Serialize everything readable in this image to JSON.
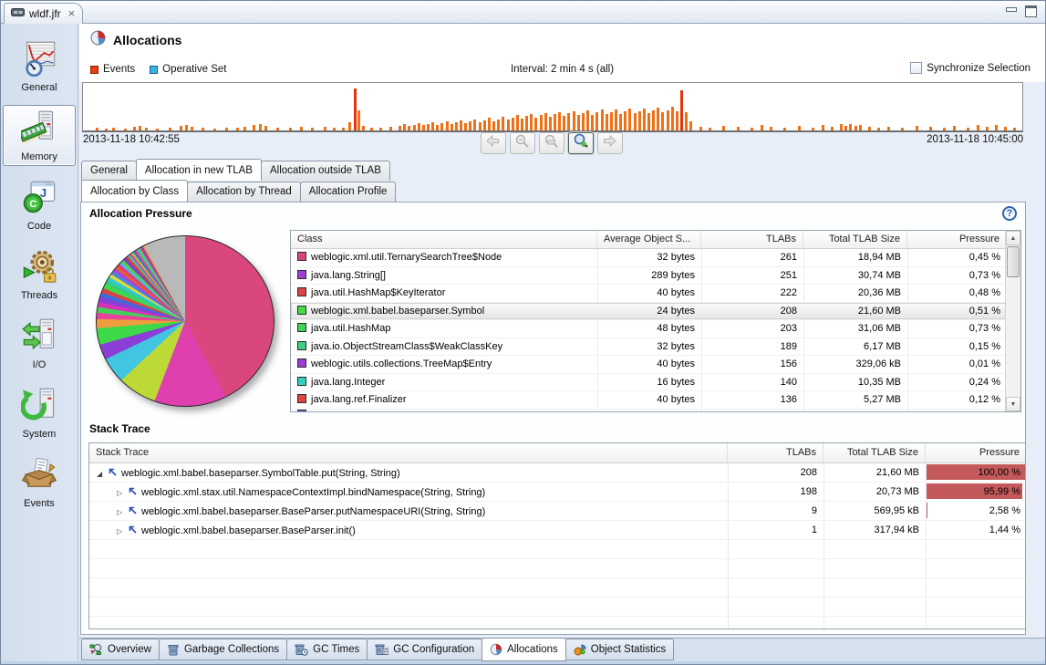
{
  "window": {
    "tab_title": "wldf.jfr"
  },
  "sidebar": {
    "items": [
      {
        "label": "General",
        "icon": "general",
        "selected": false
      },
      {
        "label": "Memory",
        "icon": "memory",
        "selected": true
      },
      {
        "label": "Code",
        "icon": "code",
        "selected": false
      },
      {
        "label": "Threads",
        "icon": "threads",
        "selected": false
      },
      {
        "label": "I/O",
        "icon": "io",
        "selected": false
      },
      {
        "label": "System",
        "icon": "system",
        "selected": false
      },
      {
        "label": "Events",
        "icon": "events",
        "selected": false
      }
    ]
  },
  "header": {
    "title": "Allocations"
  },
  "legend": {
    "events": "Events",
    "operative_set": "Operative Set",
    "interval": "Interval: 2 min 4 s (all)",
    "sync": "Synchronize Selection"
  },
  "timeline": {
    "start": "2013-11-18 10:42:55",
    "end": "2013-11-18 10:45:00",
    "bar_color": "#f07017",
    "spike_color": "#e5330e",
    "bars": [
      [
        1.4,
        5
      ],
      [
        2.3,
        4
      ],
      [
        3.1,
        6
      ],
      [
        4.4,
        4
      ],
      [
        5.3,
        7
      ],
      [
        5.9,
        9
      ],
      [
        6.6,
        6
      ],
      [
        7.8,
        4
      ],
      [
        9.1,
        5
      ],
      [
        10.3,
        10
      ],
      [
        10.9,
        12
      ],
      [
        11.5,
        8
      ],
      [
        12.6,
        5
      ],
      [
        13.9,
        4
      ],
      [
        15.1,
        6
      ],
      [
        16.3,
        5
      ],
      [
        17.1,
        7
      ],
      [
        18.1,
        11
      ],
      [
        18.7,
        13
      ],
      [
        19.3,
        9
      ],
      [
        20.6,
        5
      ],
      [
        21.9,
        6
      ],
      [
        23.1,
        8
      ],
      [
        24.3,
        5
      ],
      [
        25.6,
        7
      ],
      [
        26.6,
        5
      ],
      [
        27.6,
        6
      ],
      [
        28.3,
        18
      ],
      [
        28.8,
        88,
        1
      ],
      [
        29.2,
        42
      ],
      [
        29.7,
        10
      ],
      [
        30.6,
        6
      ],
      [
        31.6,
        5
      ],
      [
        32.6,
        7
      ],
      [
        33.6,
        10
      ],
      [
        34.1,
        13
      ],
      [
        34.6,
        9
      ],
      [
        35.1,
        12
      ],
      [
        35.6,
        15
      ],
      [
        36.1,
        11
      ],
      [
        36.6,
        14
      ],
      [
        37.1,
        17
      ],
      [
        37.6,
        12
      ],
      [
        38.1,
        15
      ],
      [
        38.6,
        19
      ],
      [
        39.1,
        14
      ],
      [
        39.6,
        17
      ],
      [
        40.1,
        21
      ],
      [
        40.6,
        16
      ],
      [
        41.1,
        19
      ],
      [
        41.6,
        23
      ],
      [
        42.1,
        18
      ],
      [
        42.6,
        22
      ],
      [
        43.1,
        26
      ],
      [
        43.6,
        20
      ],
      [
        44.1,
        24
      ],
      [
        44.6,
        29
      ],
      [
        45.1,
        23
      ],
      [
        45.6,
        27
      ],
      [
        46.1,
        32
      ],
      [
        46.6,
        25
      ],
      [
        47.1,
        30
      ],
      [
        47.6,
        35
      ],
      [
        48.1,
        27
      ],
      [
        48.6,
        32
      ],
      [
        49.1,
        37
      ],
      [
        49.6,
        29
      ],
      [
        50.1,
        34
      ],
      [
        50.6,
        39
      ],
      [
        51.1,
        31
      ],
      [
        51.6,
        36
      ],
      [
        52.1,
        41
      ],
      [
        52.6,
        32
      ],
      [
        53.1,
        37
      ],
      [
        53.6,
        43
      ],
      [
        54.1,
        33
      ],
      [
        54.6,
        38
      ],
      [
        55.1,
        44
      ],
      [
        55.6,
        34
      ],
      [
        56.1,
        39
      ],
      [
        56.6,
        45
      ],
      [
        57.1,
        35
      ],
      [
        57.6,
        40
      ],
      [
        58.1,
        46
      ],
      [
        58.6,
        36
      ],
      [
        59.1,
        41
      ],
      [
        59.6,
        47
      ],
      [
        60.1,
        37
      ],
      [
        60.6,
        42
      ],
      [
        61.1,
        48
      ],
      [
        61.6,
        38
      ],
      [
        62.1,
        43
      ],
      [
        62.6,
        50
      ],
      [
        63.1,
        40
      ],
      [
        63.6,
        85,
        1
      ],
      [
        64.1,
        38
      ],
      [
        64.6,
        20
      ],
      [
        65.6,
        8
      ],
      [
        66.6,
        6
      ],
      [
        68.1,
        10
      ],
      [
        69.6,
        7
      ],
      [
        71.1,
        5
      ],
      [
        72.1,
        12
      ],
      [
        73.1,
        8
      ],
      [
        74.6,
        6
      ],
      [
        76.1,
        9
      ],
      [
        77.6,
        5
      ],
      [
        78.6,
        11
      ],
      [
        79.6,
        7
      ],
      [
        80.6,
        13
      ],
      [
        81.1,
        9
      ],
      [
        81.6,
        14
      ],
      [
        82.1,
        10
      ],
      [
        82.6,
        12
      ],
      [
        83.6,
        7
      ],
      [
        84.6,
        5
      ],
      [
        85.6,
        8
      ],
      [
        87.1,
        6
      ],
      [
        88.6,
        10
      ],
      [
        90.1,
        7
      ],
      [
        91.6,
        5
      ],
      [
        92.6,
        9
      ],
      [
        94.1,
        6
      ],
      [
        95.1,
        11
      ],
      [
        96.1,
        8
      ],
      [
        97.1,
        12
      ],
      [
        98.1,
        7
      ],
      [
        99.0,
        5
      ]
    ]
  },
  "toolbar": {
    "buttons": [
      {
        "name": "back",
        "icon": "arrow-left",
        "enabled": false
      },
      {
        "name": "zoom-out",
        "icon": "mag-minus",
        "enabled": false
      },
      {
        "name": "zoom-selection",
        "icon": "mag-select",
        "enabled": false
      },
      {
        "name": "zoom-in",
        "icon": "mag-plus",
        "enabled": true
      },
      {
        "name": "forward",
        "icon": "arrow-right",
        "enabled": false
      }
    ]
  },
  "tabs_row1": [
    {
      "label": "General",
      "active": false
    },
    {
      "label": "Allocation in new TLAB",
      "active": true
    },
    {
      "label": "Allocation outside TLAB",
      "active": false
    }
  ],
  "tabs_row2": [
    {
      "label": "Allocation by Class",
      "active": true
    },
    {
      "label": "Allocation by Thread",
      "active": false
    },
    {
      "label": "Allocation Profile",
      "active": false
    }
  ],
  "allocation_pressure": {
    "title": "Allocation Pressure",
    "help": "?",
    "columns": [
      "Class",
      "Average Object S...",
      "TLABs",
      "Total TLAB Size",
      "Pressure"
    ],
    "rows": [
      {
        "color": "#d9477e",
        "class": "weblogic.xml.util.TernarySearchTree$Node",
        "avg": "32 bytes",
        "tlabs": "261",
        "size": "18,94 MB",
        "pressure": "0,45 %",
        "selected": false
      },
      {
        "color": "#9b3fd6",
        "class": "java.lang.String[]",
        "avg": "289 bytes",
        "tlabs": "251",
        "size": "30,74 MB",
        "pressure": "0,73 %",
        "selected": false
      },
      {
        "color": "#dd4444",
        "class": "java.util.HashMap$KeyIterator",
        "avg": "40 bytes",
        "tlabs": "222",
        "size": "20,36 MB",
        "pressure": "0,48 %",
        "selected": false
      },
      {
        "color": "#44dd44",
        "class": "weblogic.xml.babel.baseparser.Symbol",
        "avg": "24 bytes",
        "tlabs": "208",
        "size": "21,60 MB",
        "pressure": "0,51 %",
        "selected": true
      },
      {
        "color": "#3fd455",
        "class": "java.util.HashMap",
        "avg": "48 bytes",
        "tlabs": "203",
        "size": "31,06 MB",
        "pressure": "0,73 %",
        "selected": false
      },
      {
        "color": "#3bd088",
        "class": "java.io.ObjectStreamClass$WeakClassKey",
        "avg": "32 bytes",
        "tlabs": "189",
        "size": "6,17 MB",
        "pressure": "0,15 %",
        "selected": false
      },
      {
        "color": "#9b3fd6",
        "class": "weblogic.utils.collections.TreeMap$Entry",
        "avg": "40 bytes",
        "tlabs": "156",
        "size": "329,06 kB",
        "pressure": "0,01 %",
        "selected": false
      },
      {
        "color": "#35cfc3",
        "class": "java.lang.Integer",
        "avg": "16 bytes",
        "tlabs": "140",
        "size": "10,35 MB",
        "pressure": "0,24 %",
        "selected": false
      },
      {
        "color": "#dd4444",
        "class": "java.lang.ref.Finalizer",
        "avg": "40 bytes",
        "tlabs": "136",
        "size": "5,27 MB",
        "pressure": "0,12 %",
        "selected": false
      }
    ],
    "partial_row_color": "#4169d9"
  },
  "pie": {
    "slices": [
      {
        "color": "#d9477e",
        "value": 40.5
      },
      {
        "color": "#e03fae",
        "value": 13.2
      },
      {
        "color": "#bcd935",
        "value": 7.0
      },
      {
        "color": "#41c5e0",
        "value": 4.6
      },
      {
        "color": "#8b3fd6",
        "value": 2.7
      },
      {
        "color": "#3ed948",
        "value": 2.9
      },
      {
        "color": "#ee9e3d",
        "value": 1.6
      },
      {
        "color": "#e8439a",
        "value": 1.1
      },
      {
        "color": "#44d058",
        "value": 1.0
      },
      {
        "color": "#d633b8",
        "value": 0.9
      },
      {
        "color": "#8b3fd6",
        "value": 0.9
      },
      {
        "color": "#4169d9",
        "value": 0.8
      },
      {
        "color": "#dd4343",
        "value": 0.8
      },
      {
        "color": "#3ed948",
        "value": 0.8
      },
      {
        "color": "#35cc8a",
        "value": 0.7
      },
      {
        "color": "#35c9c9",
        "value": 0.7
      },
      {
        "color": "#e3db3a",
        "value": 0.6
      },
      {
        "color": "#4787e0",
        "value": 0.6
      },
      {
        "color": "#a346dd",
        "value": 0.6
      },
      {
        "color": "#e65a35",
        "value": 0.6
      },
      {
        "color": "#dd3b77",
        "value": 0.5
      },
      {
        "color": "#52b7e8",
        "value": 0.5
      },
      {
        "color": "#58d03e",
        "value": 0.5
      },
      {
        "color": "#7a3fd6",
        "value": 0.5
      },
      {
        "color": "#d94040",
        "value": 0.5
      },
      {
        "color": "#3bc9a0",
        "value": 0.4
      },
      {
        "color": "#e03fae",
        "value": 0.4
      },
      {
        "color": "#a8c930",
        "value": 0.4
      },
      {
        "color": "#3f6fd9",
        "value": 0.4
      },
      {
        "color": "#e8439a",
        "value": 0.35
      },
      {
        "color": "#44d058",
        "value": 0.35
      },
      {
        "color": "#41c5e0",
        "value": 0.3
      },
      {
        "color": "#dd4343",
        "value": 0.3
      },
      {
        "color": "#8b3fd6",
        "value": 0.3
      },
      {
        "color": "#ee9e3d",
        "value": 0.3
      },
      {
        "color": "#b9b9b9",
        "value": 7.6
      }
    ]
  },
  "stack_trace": {
    "title": "Stack Trace",
    "columns": [
      "Stack Trace",
      "TLABs",
      "Total TLAB Size",
      "Pressure"
    ],
    "rows": [
      {
        "depth": 0,
        "expanded": true,
        "method": "weblogic.xml.babel.baseparser.SymbolTable.put(String, String)",
        "tlabs": "208",
        "size": "21,60 MB",
        "pressure": "100,00 %",
        "bar": 100
      },
      {
        "depth": 1,
        "expanded": false,
        "method": "weblogic.xml.stax.util.NamespaceContextImpl.bindNamespace(String, String)",
        "tlabs": "198",
        "size": "20,73 MB",
        "pressure": "95,99 %",
        "bar": 96
      },
      {
        "depth": 1,
        "expanded": false,
        "method": "weblogic.xml.babel.baseparser.BaseParser.putNamespaceURI(String, String)",
        "tlabs": "9",
        "size": "569,95 kB",
        "pressure": "2,58 %",
        "bar": 3
      },
      {
        "depth": 1,
        "expanded": false,
        "method": "weblogic.xml.babel.baseparser.BaseParser.init()",
        "tlabs": "1",
        "size": "317,94 kB",
        "pressure": "1,44 %",
        "bar": 0
      }
    ],
    "empty_rows": 5
  },
  "bottom_tabs": [
    {
      "label": "Overview",
      "icon": "overview",
      "selected": false
    },
    {
      "label": "Garbage Collections",
      "icon": "gc",
      "selected": false
    },
    {
      "label": "GC Times",
      "icon": "gctimes",
      "selected": false
    },
    {
      "label": "GC Configuration",
      "icon": "gcconfig",
      "selected": false
    },
    {
      "label": "Allocations",
      "icon": "alloc",
      "selected": true
    },
    {
      "label": "Object Statistics",
      "icon": "objstats",
      "selected": false
    }
  ]
}
